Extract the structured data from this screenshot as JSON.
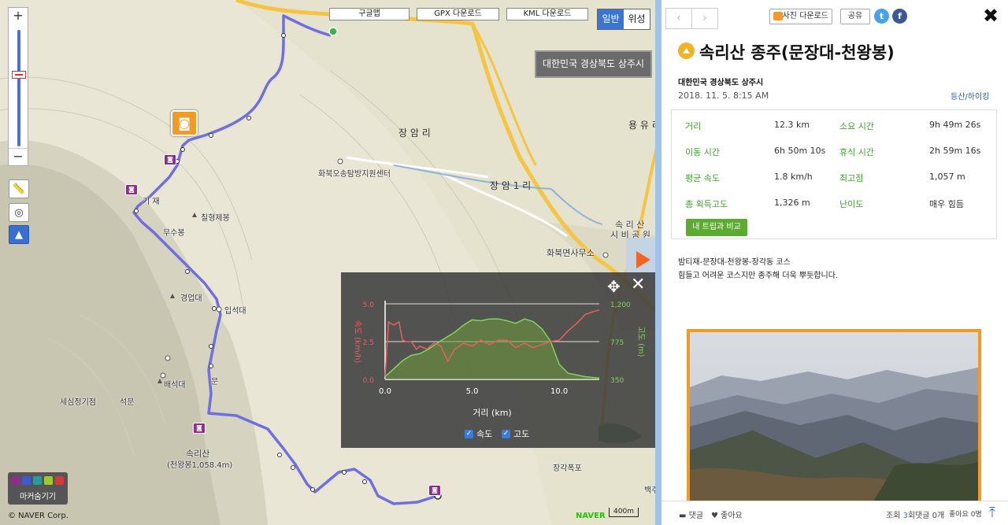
{
  "map": {
    "download_buttons": [
      "구글맵",
      "GPX 다운로드",
      "KML 다운로드"
    ],
    "map_types": [
      "일반",
      "위성"
    ],
    "region_label": "대한민국 경상북도 상주시",
    "places": {
      "jangam": "장 암 리",
      "jangam1": "장 암 1 리",
      "yongyu": "용 유 리",
      "center": "화북오송탐방지원센터",
      "chilhyeong": "칠형제봉",
      "munsu": "무수봉",
      "gyeongeop": "경업대",
      "ipseok": "입석대",
      "baekseok": "배석대",
      "sesim": "세심정기점",
      "seokmun": "석문",
      "songnisan": "속리산",
      "cheonwang": "(천왕봉1,058.4m)",
      "office": "화북면사무소",
      "songni_park": "속 리 산",
      "park2": "시 비 공 원",
      "jangak": "장각폭포",
      "mun": "문",
      "gi_jae": "기 재",
      "baekju": "백주"
    },
    "marker_hide_label": "마커숨기기",
    "copyright": "© NAVER Corp.",
    "naver": "NAVER",
    "scale": "400m"
  },
  "chart_data": {
    "type": "line",
    "xlabel": "거리 (km)",
    "ylabel_left": "속도 (km/h)",
    "ylabel_right": "고도 (m)",
    "x_ticks": [
      "0.0",
      "5.0",
      "10.0"
    ],
    "y_left_ticks": [
      "0.0",
      "2.5",
      "5.0"
    ],
    "y_right_ticks": [
      "350",
      "775",
      "1,200"
    ],
    "xlim": [
      0,
      12.3
    ],
    "ylim_left": [
      0,
      5
    ],
    "ylim_right": [
      350,
      1200
    ],
    "series": [
      {
        "name": "속도",
        "color": "#e86060",
        "x": [
          0,
          0.2,
          0.5,
          0.8,
          1.0,
          1.2,
          1.5,
          1.8,
          2.0,
          2.4,
          2.8,
          3.2,
          3.6,
          4.0,
          4.5,
          5.0,
          5.5,
          6.0,
          6.5,
          7.0,
          7.5,
          8.0,
          8.5,
          9.0,
          9.5,
          10.0,
          10.5,
          11.0,
          11.5,
          12.0,
          12.3
        ],
        "y": [
          0.2,
          3.8,
          3.6,
          3.8,
          2.6,
          2.5,
          2.5,
          2.0,
          2.2,
          2.0,
          2.4,
          2.2,
          1.2,
          2.0,
          2.4,
          2.2,
          2.6,
          2.3,
          2.6,
          2.6,
          2.1,
          2.4,
          2.1,
          2.3,
          2.5,
          2.6,
          3.2,
          3.7,
          4.3,
          4.5,
          4.6
        ]
      },
      {
        "name": "고도",
        "color": "#7fd65a",
        "x": [
          0,
          0.5,
          1.0,
          1.5,
          2.0,
          2.5,
          3.0,
          3.5,
          4.0,
          4.5,
          5.0,
          5.5,
          6.0,
          6.5,
          7.0,
          7.5,
          8.0,
          8.5,
          9.0,
          9.5,
          10.0,
          10.5,
          11.0,
          11.5,
          12.0,
          12.3
        ],
        "y": [
          380,
          470,
          560,
          620,
          640,
          690,
          760,
          820,
          880,
          960,
          1020,
          1010,
          1030,
          1030,
          1010,
          980,
          1030,
          1000,
          920,
          780,
          520,
          420,
          400,
          380,
          370,
          365
        ]
      }
    ],
    "legend": [
      "속도",
      "고도"
    ],
    "grid": true
  },
  "panel": {
    "photo_download": "사진 다운로드",
    "share": "공유",
    "title": "속리산 종주(문장대-천왕봉)",
    "location": "대한민국 경상북도 상주시",
    "date": "2018. 11. 5. 8:15 AM",
    "category": "등산/하이킹",
    "stats": [
      {
        "label": "거리",
        "value": "12.3 km"
      },
      {
        "label": "소요 시간",
        "value": "9h 49m 26s"
      },
      {
        "label": "이동 시간",
        "value": "6h 50m 10s"
      },
      {
        "label": "휴식 시간",
        "value": "2h 59m 16s"
      },
      {
        "label": "평균 속도",
        "value": "1.8 km/h"
      },
      {
        "label": "최고점",
        "value": "1,057 m"
      },
      {
        "label": "총 획득고도",
        "value": "1,326 m"
      },
      {
        "label": "난이도",
        "value": "매우 힘듬"
      }
    ],
    "compare_button": "내 트립과 비교",
    "desc_line1": "밤티재-문장대-천왕봉-장각동 코스",
    "desc_line2": "힘들고 어려운 코스지만 종주해 더욱 뿌듯합니다.",
    "footer": {
      "comment": "댓글",
      "like": "좋아요",
      "views_label": "조회",
      "views": "3",
      "views_unit": "회",
      "comments_count": "댓글 0개",
      "likes_count": "좋아요 0명"
    }
  }
}
